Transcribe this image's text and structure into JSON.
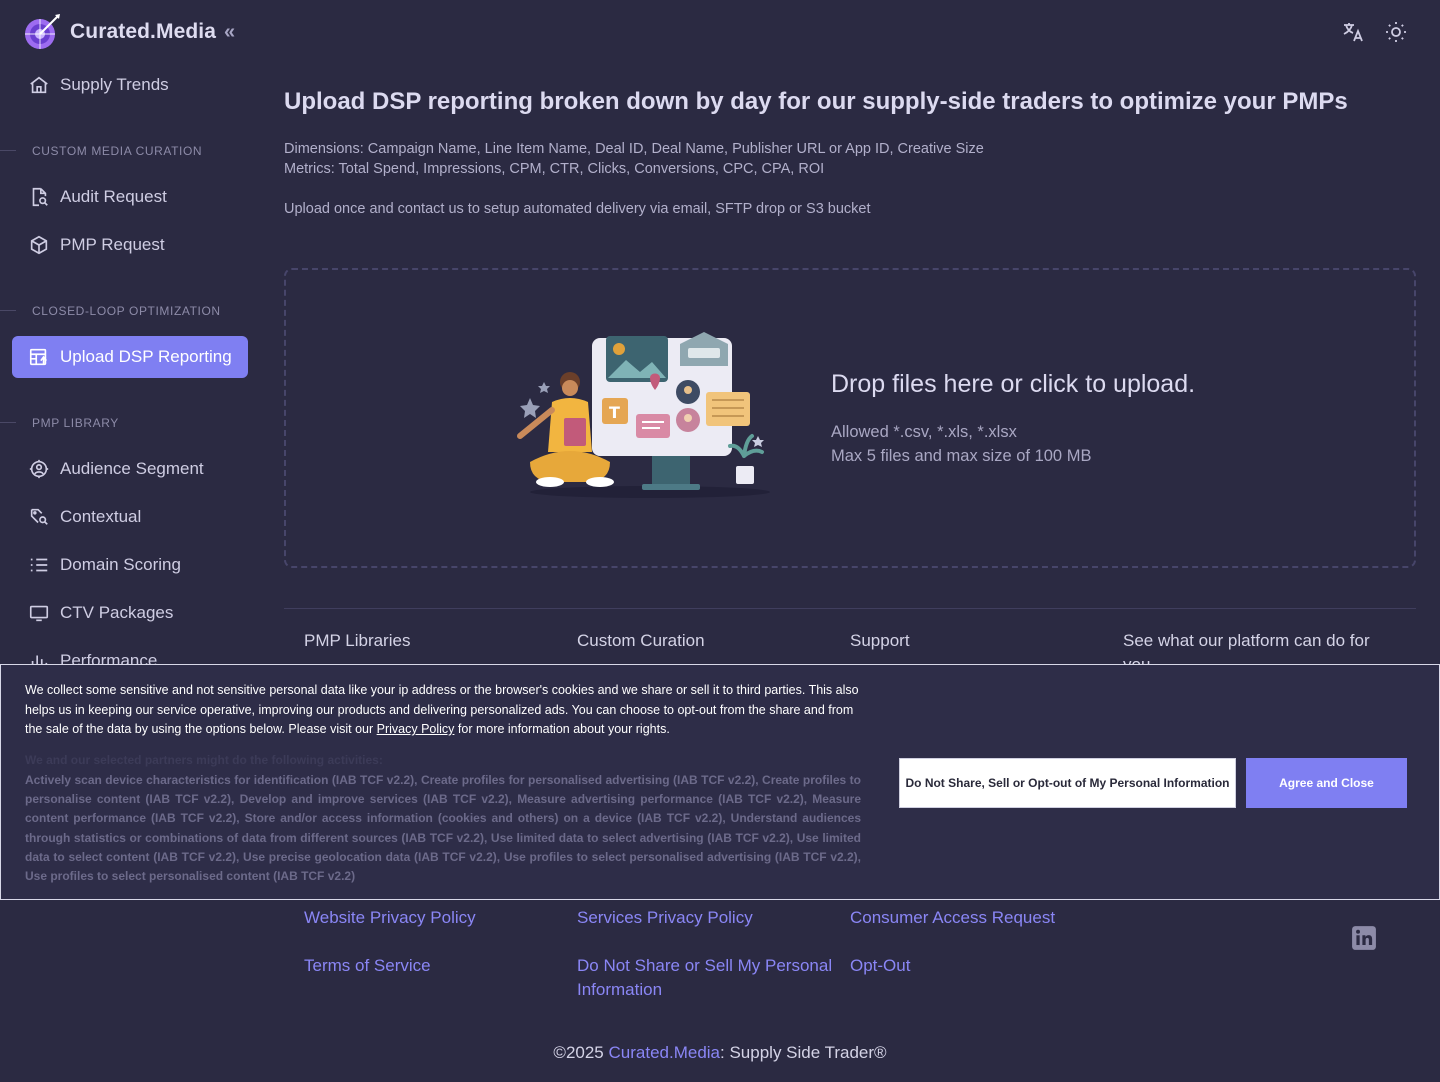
{
  "brand": {
    "name": "Curated.Media"
  },
  "sidebar": {
    "items": [
      {
        "label": "Supply Trends"
      },
      {
        "label": "Audit Request"
      },
      {
        "label": "PMP Request"
      },
      {
        "label": "Upload DSP Reporting"
      },
      {
        "label": "Audience Segment"
      },
      {
        "label": "Contextual"
      },
      {
        "label": "Domain Scoring"
      },
      {
        "label": "CTV Packages"
      },
      {
        "label": "Performance"
      }
    ],
    "sections": [
      "CUSTOM MEDIA CURATION",
      "CLOSED-LOOP OPTIMIZATION",
      "PMP LIBRARY"
    ]
  },
  "main": {
    "title": "Upload DSP reporting broken down by day for our supply-side traders to optimize your PMPs",
    "dimensions": "Dimensions: Campaign Name, Line Item Name, Deal ID, Deal Name, Publisher URL or App ID, Creative Size",
    "metrics": "Metrics: Total Spend, Impressions, CPM, CTR, Clicks, Conversions, CPC, CPA, ROI",
    "upload_note": "Upload once and contact us to setup automated delivery via email, SFTP drop or S3 bucket"
  },
  "dropzone": {
    "title": "Drop files here or click to upload.",
    "allowed": "Allowed *.csv, *.xls, *.xlsx",
    "limits": "Max 5 files and max size of 100 MB"
  },
  "footer": {
    "columns": [
      "PMP Libraries",
      "Custom Curation",
      "Support",
      "See what our platform can do for you"
    ],
    "links": {
      "website_privacy": "Website Privacy Policy",
      "services_privacy": "Services Privacy Policy",
      "consumer_access": "Consumer Access Request",
      "terms": "Terms of Service",
      "do_not_share": "Do Not Share or Sell My Personal Information",
      "opt_out": "Opt-Out"
    },
    "copyright_prefix": "©2025 ",
    "copyright_brand": "Curated.Media",
    "copyright_suffix": ": Supply Side Trader®"
  },
  "consent": {
    "text_before_link": "We collect some sensitive and not sensitive personal data like your ip address or the browser's cookies and we share or sell it to third parties. This also helps us in keeping our service operative, improving our products and delivering personalized ads. You can choose to opt-out from the share and from the sale of the data by using the options below. Please visit our ",
    "link_text": "Privacy Policy",
    "text_after_link": " for more information about your rights.",
    "faded_heading": "We and our selected partners might do the following activities:",
    "purposes": "Actively scan device characteristics for identification (IAB TCF v2.2), Create profiles for personalised advertising (IAB TCF v2.2), Create profiles to personalise content (IAB TCF v2.2), Develop and improve services (IAB TCF v2.2), Measure advertising performance (IAB TCF v2.2), Measure content performance (IAB TCF v2.2), Store and/or access information (cookies and others) on a device (IAB TCF v2.2), Understand audiences through statistics or combinations of data from different sources (IAB TCF v2.2), Use limited data to select advertising (IAB TCF v2.2), Use limited data to select content (IAB TCF v2.2), Use precise geolocation data (IAB TCF v2.2), Use profiles to select personalised advertising (IAB TCF v2.2), Use profiles to select personalised content (IAB TCF v2.2)",
    "optout_button": "Do Not Share, Sell or Opt-out of My Personal Information",
    "agree_button": "Agree and Close"
  },
  "icons": {
    "translate": "translate-icon",
    "theme": "sun-icon",
    "linkedin": "linkedin-icon"
  },
  "colors": {
    "accent": "#7f7ff2",
    "background": "#2b2a42",
    "link": "#8a86f5"
  }
}
